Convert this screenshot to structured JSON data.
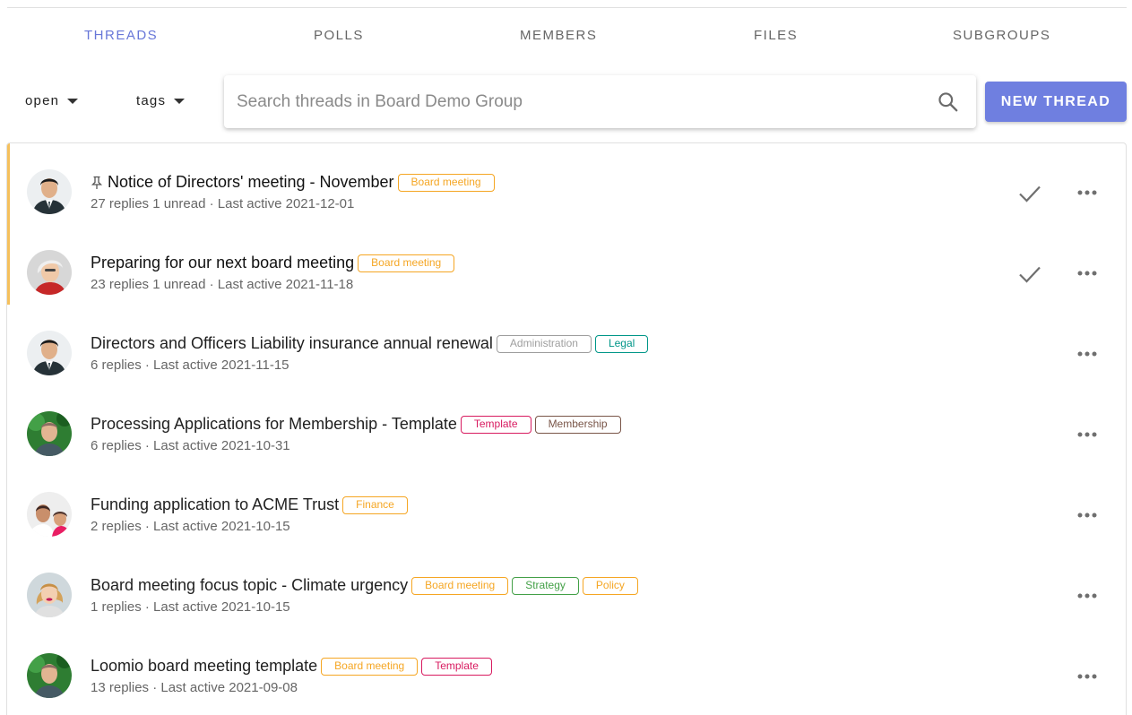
{
  "tabs": [
    {
      "label": "THREADS",
      "active": true
    },
    {
      "label": "POLLS",
      "active": false
    },
    {
      "label": "MEMBERS",
      "active": false
    },
    {
      "label": "FILES",
      "active": false
    },
    {
      "label": "SUBGROUPS",
      "active": false
    }
  ],
  "filters": {
    "status_label": "open",
    "tags_label": "tags"
  },
  "search": {
    "placeholder": "Search threads in Board Demo Group"
  },
  "new_thread_label": "NEW THREAD",
  "colors": {
    "accent": "#6877d8",
    "button": "#6f7fe0",
    "unread_marker": "#f5c05c",
    "tag_board_meeting": "#f5a623",
    "tag_administration": "#9e9e9e",
    "tag_legal": "#009688",
    "tag_template": "#d81b60",
    "tag_membership": "#795548",
    "tag_finance": "#f5a623",
    "tag_strategy": "#43a047",
    "tag_policy": "#f5a623"
  },
  "threads": [
    {
      "title": "Notice of Directors' meeting - November",
      "pinned": true,
      "unread": true,
      "meta": "27 replies 1 unread · Last active 2021-12-01",
      "tags": [
        {
          "label": "Board meeting",
          "color": "#f5a623"
        }
      ],
      "avatar": "man-asian-suit",
      "icons": [
        "pin-icon",
        "check-icon",
        "more-icon"
      ]
    },
    {
      "title": "Preparing for our next board meeting",
      "pinned": false,
      "unread": true,
      "meta": "23 replies 1 unread · Last active 2021-11-18",
      "tags": [
        {
          "label": "Board meeting",
          "color": "#f5a623"
        }
      ],
      "avatar": "woman-grey-hair",
      "icons": [
        "check-icon",
        "more-icon"
      ]
    },
    {
      "title": "Directors and Officers Liability insurance annual renewal",
      "pinned": false,
      "unread": false,
      "meta": "6 replies  · Last active 2021-11-15",
      "tags": [
        {
          "label": "Administration",
          "color": "#9e9e9e"
        },
        {
          "label": "Legal",
          "color": "#009688"
        }
      ],
      "avatar": "man-asian-suit",
      "icons": [
        "more-icon"
      ]
    },
    {
      "title": "Processing Applications for Membership - Template",
      "pinned": false,
      "unread": false,
      "meta": "6 replies  · Last active 2021-10-31",
      "tags": [
        {
          "label": "Template",
          "color": "#d81b60"
        },
        {
          "label": "Membership",
          "color": "#795548"
        }
      ],
      "avatar": "man-outdoor",
      "icons": [
        "more-icon"
      ]
    },
    {
      "title": "Funding application to ACME Trust",
      "pinned": false,
      "unread": false,
      "meta": "2 replies  · Last active 2021-10-15",
      "tags": [
        {
          "label": "Finance",
          "color": "#f5a623"
        }
      ],
      "avatar": "father-child",
      "icons": [
        "more-icon"
      ]
    },
    {
      "title": "Board meeting focus topic - Climate urgency",
      "pinned": false,
      "unread": false,
      "meta": "1 replies  · Last active 2021-10-15",
      "tags": [
        {
          "label": "Board meeting",
          "color": "#f5a623"
        },
        {
          "label": "Strategy",
          "color": "#43a047"
        },
        {
          "label": "Policy",
          "color": "#f5a623"
        }
      ],
      "avatar": "woman-blonde",
      "icons": [
        "more-icon"
      ]
    },
    {
      "title": "Loomio board meeting template",
      "pinned": false,
      "unread": false,
      "meta": "13 replies  · Last active 2021-09-08",
      "tags": [
        {
          "label": "Board meeting",
          "color": "#f5a623"
        },
        {
          "label": "Template",
          "color": "#d81b60"
        }
      ],
      "avatar": "man-outdoor",
      "icons": [
        "more-icon"
      ]
    }
  ]
}
